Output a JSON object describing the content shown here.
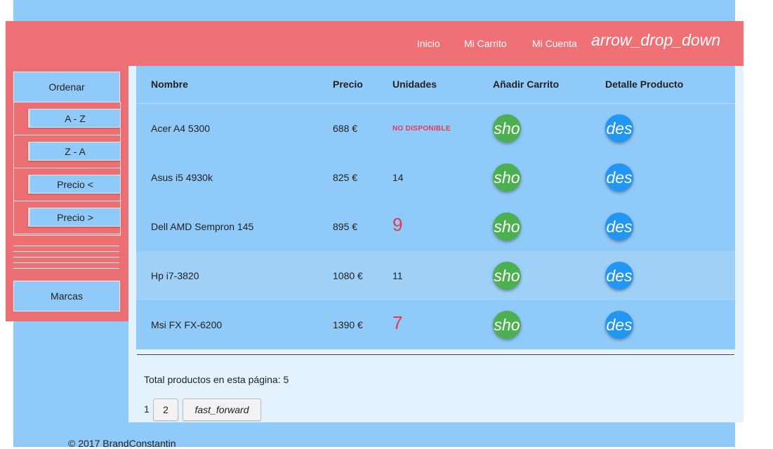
{
  "nav": {
    "links": [
      "Inicio",
      "Mi Carrito",
      "Mi Cuenta"
    ],
    "dropdown_icon": "arrow_drop_down"
  },
  "sidebar": {
    "ordenar_label": "Ordenar",
    "sort_options": [
      "A - Z",
      "Z - A",
      "Precio <",
      "Precio >"
    ],
    "marcas_label": "Marcas"
  },
  "table": {
    "headers": [
      "Nombre",
      "Precio",
      "Unidades",
      "Añadir Carrito",
      "Detalle Producto"
    ],
    "rows": [
      {
        "name": "Acer A4 5300",
        "price": "688 €",
        "units": "NO DISPONIBLE",
        "units_style": "unavailable",
        "cart_icon": "sho",
        "detail_icon": "des"
      },
      {
        "name": "Asus i5 4930k",
        "price": "825 €",
        "units": "14",
        "units_style": "normal",
        "cart_icon": "sho",
        "detail_icon": "des"
      },
      {
        "name": "Dell AMD Sempron 145",
        "price": "895 €",
        "units": "9",
        "units_style": "low",
        "cart_icon": "sho",
        "detail_icon": "des"
      },
      {
        "name": "Hp i7-3820",
        "price": "1080 €",
        "units": "11",
        "units_style": "normal",
        "cart_icon": "sho",
        "detail_icon": "des"
      },
      {
        "name": "Msi FX FX-6200",
        "price": "1390 €",
        "units": "7",
        "units_style": "low",
        "cart_icon": "sho",
        "detail_icon": "des"
      }
    ]
  },
  "total_text": "Total productos en esta página: 5",
  "pagination": {
    "current": "1",
    "next_page": "2",
    "fast_forward_icon": "fast_forward"
  },
  "footer": "© 2017 BrandConstantin",
  "colors": {
    "navbar": "#ef7075",
    "page_bg": "#90caf9",
    "cart_button": "#4caf50",
    "detail_button": "#2196f3",
    "low_stock": "#e53950"
  }
}
